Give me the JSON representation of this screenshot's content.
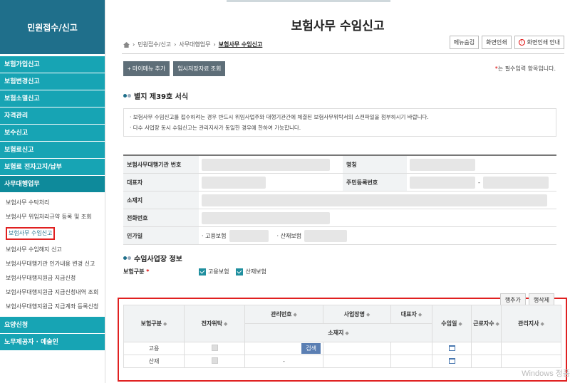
{
  "sidebar": {
    "title": "민원접수/신고",
    "menus": [
      {
        "label": "보험가입신고"
      },
      {
        "label": "보험변경신고"
      },
      {
        "label": "보험소멸신고"
      },
      {
        "label": "자격관리"
      },
      {
        "label": "보수신고"
      },
      {
        "label": "보험료신고"
      },
      {
        "label": "보험료 전자고지/납부"
      },
      {
        "label": "사무대행업무"
      }
    ],
    "subs": [
      {
        "label": "보험사무 수탁처리"
      },
      {
        "label": "보험사무 위임처리규약 등록 및 조회"
      },
      {
        "label": "보험사무 수임신고"
      },
      {
        "label": "보험사무 수임해지 신고"
      },
      {
        "label": "보험사무대행기관 인가내용 변경 신고"
      },
      {
        "label": "보험사무대행지원금 지급신청"
      },
      {
        "label": "보험사무대행지원금 지급신청내역 조회"
      },
      {
        "label": "보험사무대행지원금 지급계좌 등록신청"
      }
    ],
    "bottom_menus": [
      {
        "label": "요양신청"
      },
      {
        "label": "노무제공자 · 예술인"
      }
    ]
  },
  "page": {
    "title": "보험사무 수임신고",
    "breadcrumb": [
      "민원접수/신고",
      "사무대행업무",
      "보험사무 수임신고"
    ],
    "top_buttons": {
      "hide_menu": "메뉴숨김",
      "print": "화면인쇄",
      "print_guide": "화면인쇄 안내"
    },
    "action_buttons": {
      "add_my_menu": "+ 마이메뉴 추가",
      "temp_saved": "임시저장자료 조회"
    },
    "required_note": "는 필수입력 항목입니다.",
    "required_star": "*"
  },
  "form_section": {
    "title": "별지 제39호 서식",
    "notices": [
      "· 보험사무 수임신고를 접수하려는 경우 반드시 위임사업주와 대행기관간에 체결된 보험사무위탁서의 스캔파일을 첨부하시기 바랍니다.",
      "· 다수 사업장 동시 수임신고는 관리지사가 동일한 경우에 한하여 가능합니다."
    ]
  },
  "agency_info": {
    "labels": {
      "agency_no": "보험사무대행기관 번호",
      "name": "명칭",
      "rep": "대표자",
      "rrn": "주민등록번호",
      "address": "소재지",
      "phone": "전화번호",
      "approval": "인가일",
      "employment": "· 고용보험",
      "industrial": "· 산재보험",
      "dash": "-"
    }
  },
  "subscribed": {
    "title": "수임사업장 정보",
    "category_label": "보험구분",
    "required_star": "*",
    "options": [
      "고용보험",
      "산재보험"
    ],
    "row_buttons": {
      "add": "행추가",
      "delete": "행삭제"
    },
    "headers": {
      "ins_type": "보험구분",
      "electronic": "전자위탁",
      "mgmt_no": "관리번호",
      "biz_name": "사업장명",
      "rep": "대표자",
      "address": "소재지",
      "date": "수임일",
      "workers": "근로자수",
      "branch": "관리지사"
    },
    "rows": [
      {
        "type": "고용",
        "search": "검색",
        "dash": ""
      },
      {
        "type": "산재",
        "search": "",
        "dash": "-"
      }
    ]
  },
  "watermark": "Windows 정품",
  "colors": {
    "brand": "#1f6f8b",
    "menu": "#17a4b4",
    "highlight": "#e02020"
  }
}
